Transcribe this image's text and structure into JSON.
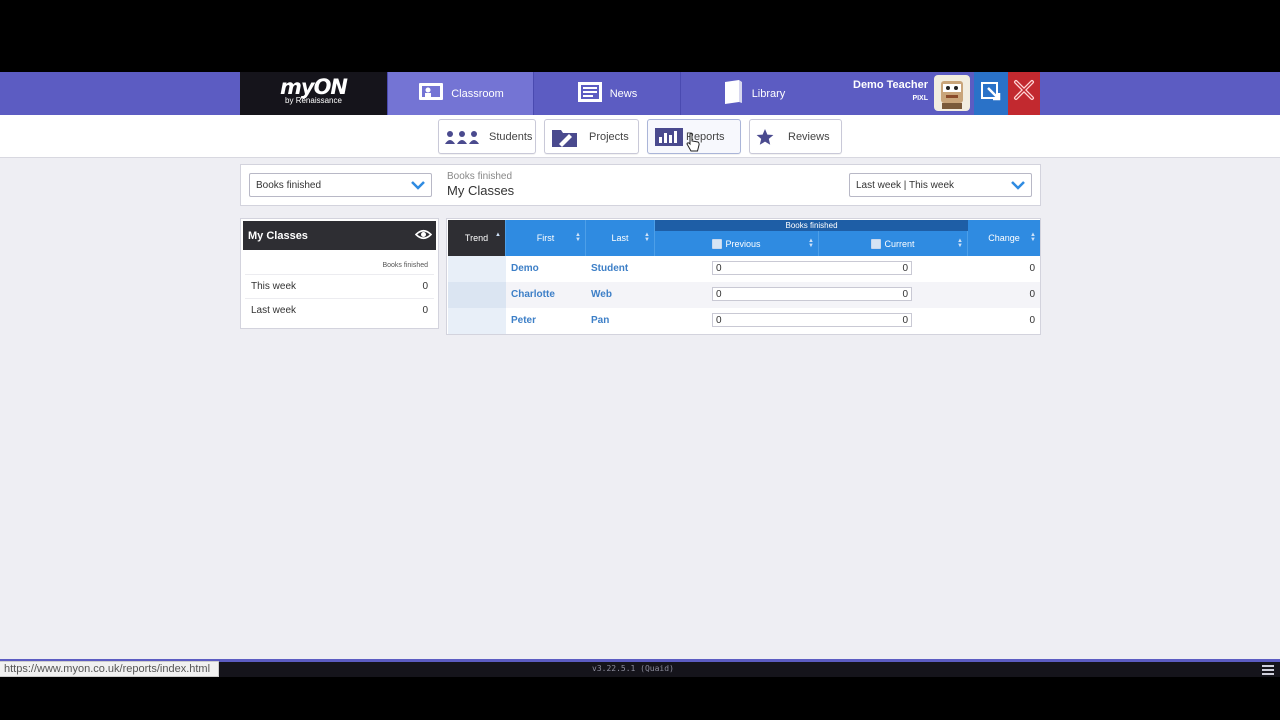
{
  "brand": {
    "name": "myON",
    "sub": "by Renaissance"
  },
  "nav": {
    "tabs": [
      {
        "label": "Classroom",
        "icon": "classroom-icon",
        "active": true
      },
      {
        "label": "News",
        "icon": "news-icon",
        "active": false
      },
      {
        "label": "Library",
        "icon": "library-icon",
        "active": false
      }
    ]
  },
  "user": {
    "name": "Demo Teacher",
    "sub": "PIXL"
  },
  "subnav": {
    "tabs": [
      {
        "label": "Students",
        "icon": "students-icon"
      },
      {
        "label": "Projects",
        "icon": "projects-icon"
      },
      {
        "label": "Reports",
        "icon": "reports-icon",
        "active": true
      },
      {
        "label": "Reviews",
        "icon": "star-icon"
      }
    ]
  },
  "filter": {
    "metric_select": "Books finished",
    "title_small": "Books finished",
    "title_big": "My Classes",
    "period_select": "Last week | This week"
  },
  "panel": {
    "title": "My Classes",
    "column_header": "Books finished",
    "rows": [
      {
        "label": "This week",
        "value": "0"
      },
      {
        "label": "Last week",
        "value": "0"
      }
    ]
  },
  "table": {
    "headers": {
      "trend": "Trend",
      "first": "First",
      "last": "Last",
      "group": "Books finished",
      "previous": "Previous",
      "current": "Current",
      "change": "Change"
    },
    "rows": [
      {
        "first": "Demo",
        "last": "Student",
        "previous": "0",
        "current": "0",
        "change": "0"
      },
      {
        "first": "Charlotte",
        "last": "Web",
        "previous": "0",
        "current": "0",
        "change": "0"
      },
      {
        "first": "Peter",
        "last": "Pan",
        "previous": "0",
        "current": "0",
        "change": "0"
      }
    ]
  },
  "footer": {
    "version": "v3.22.5.1 (Quaid)"
  },
  "status_url": "https://www.myon.co.uk/reports/index.html",
  "colors": {
    "nav": "#5c5cc2",
    "active_nav": "#7474d4",
    "table_header": "#2f8be1",
    "link": "#3d7fc7"
  }
}
